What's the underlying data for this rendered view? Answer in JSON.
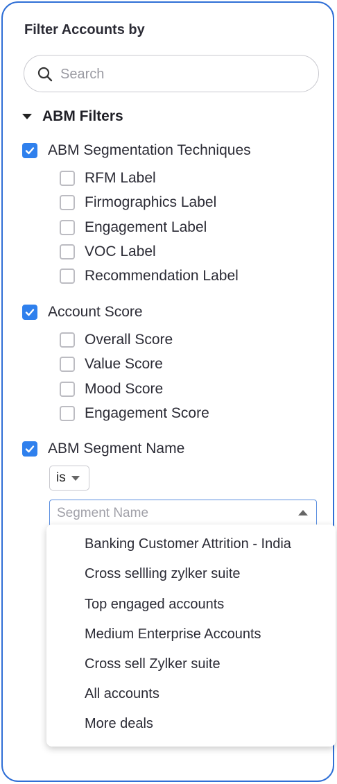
{
  "panel": {
    "title": "Filter Accounts by",
    "search_placeholder": "Search"
  },
  "section": {
    "label": "ABM Filters",
    "groups": [
      {
        "label": "ABM Segmentation Techniques",
        "checked": true,
        "children": [
          "RFM Label",
          "Firmographics Label",
          "Engagement Label",
          "VOC Label",
          "Recommendation Label"
        ]
      },
      {
        "label": "Account Score",
        "checked": true,
        "children": [
          "Overall Score",
          "Value Score",
          "Mood Score",
          "Engagement Score"
        ]
      },
      {
        "label": "ABM Segment Name",
        "checked": true,
        "children": []
      }
    ]
  },
  "segment_filter": {
    "operator": "is",
    "placeholder": "Segment Name",
    "options": [
      "Banking Customer Attrition - India",
      "Cross sellling zylker suite",
      "Top engaged accounts",
      "Medium Enterprise Accounts",
      "Cross sell Zylker suite",
      "All accounts",
      "More deals"
    ]
  },
  "colors": {
    "accent": "#2f80ed",
    "border": "#2f6fd6"
  }
}
